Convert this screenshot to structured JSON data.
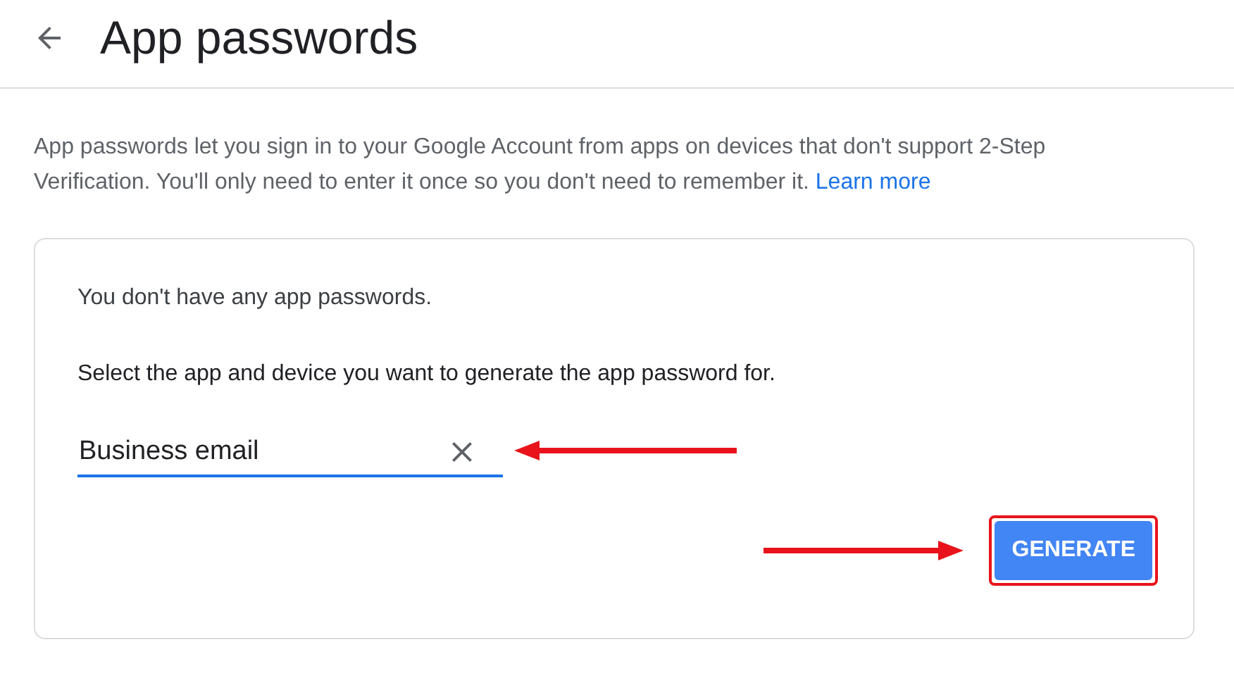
{
  "header": {
    "title": "App passwords"
  },
  "description": {
    "text": "App passwords let you sign in to your Google Account from apps on devices that don't support 2-Step Verification. You'll only need to enter it once so you don't need to remember it.",
    "link": "Learn more"
  },
  "card": {
    "empty_message": "You don't have any app passwords.",
    "instruction": "Select the app and device you want to generate the app password for.",
    "field": {
      "value": "Business email"
    },
    "button": "GENERATE"
  }
}
